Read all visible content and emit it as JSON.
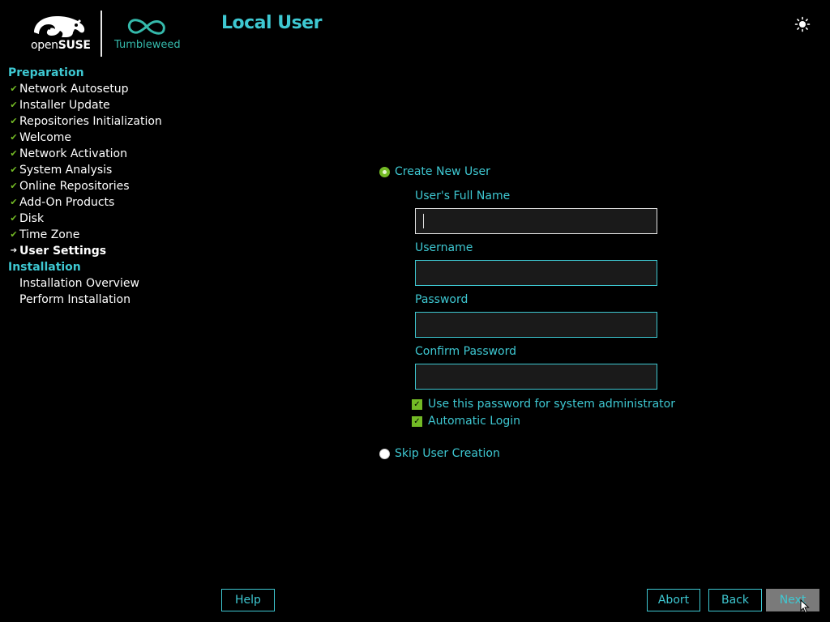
{
  "header": {
    "brand_light": "open",
    "brand_bold": "SUSE",
    "product": "Tumbleweed",
    "page_title": "Local User",
    "theme_icon": "sun-icon"
  },
  "sidebar": {
    "sections": [
      {
        "title": "Preparation",
        "steps": [
          {
            "label": "Network Autosetup",
            "state": "done"
          },
          {
            "label": "Installer Update",
            "state": "done"
          },
          {
            "label": "Repositories Initialization",
            "state": "done"
          },
          {
            "label": "Welcome",
            "state": "done"
          },
          {
            "label": "Network Activation",
            "state": "done"
          },
          {
            "label": "System Analysis",
            "state": "done"
          },
          {
            "label": "Online Repositories",
            "state": "done"
          },
          {
            "label": "Add-On Products",
            "state": "done"
          },
          {
            "label": "Disk",
            "state": "done"
          },
          {
            "label": "Time Zone",
            "state": "done"
          },
          {
            "label": "User Settings",
            "state": "current"
          }
        ]
      },
      {
        "title": "Installation",
        "steps": [
          {
            "label": "Installation Overview",
            "state": "pending"
          },
          {
            "label": "Perform Installation",
            "state": "pending"
          }
        ]
      }
    ]
  },
  "form": {
    "create_user": {
      "label": "Create New User",
      "checked": true
    },
    "full_name": {
      "label": "User's Full Name",
      "value": ""
    },
    "username": {
      "label": "Username",
      "value": ""
    },
    "password": {
      "label": "Password",
      "value": ""
    },
    "confirm_password": {
      "label": "Confirm Password",
      "value": ""
    },
    "use_for_admin": {
      "label": "Use this password for system administrator",
      "checked": true
    },
    "auto_login": {
      "label": "Automatic Login",
      "checked": true
    },
    "skip_user": {
      "label": "Skip User Creation",
      "checked": false
    }
  },
  "buttons": {
    "help": "Help",
    "abort": "Abort",
    "back": "Back",
    "next": "Next"
  },
  "colors": {
    "accent": "#3ec8d2",
    "check_green": "#73ba25",
    "tumbleweed": "#35b9ab",
    "background": "#000000"
  }
}
